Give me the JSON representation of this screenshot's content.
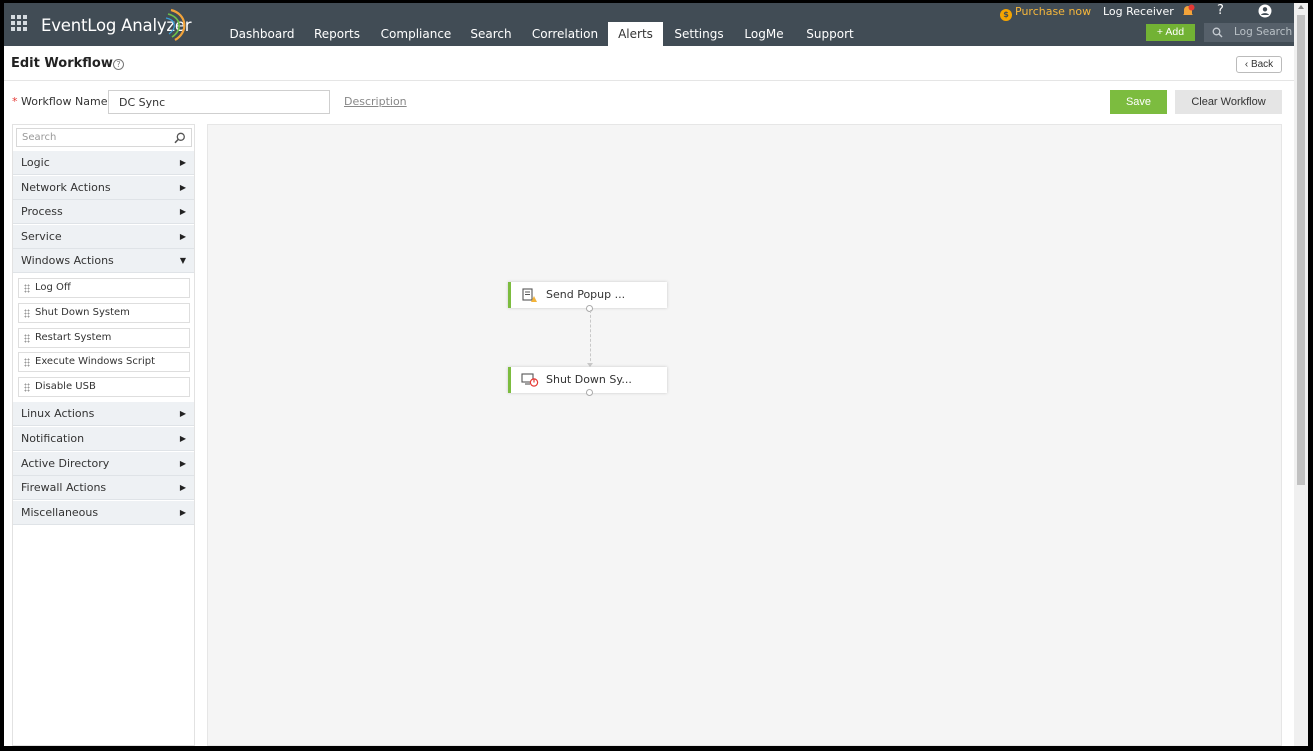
{
  "app": {
    "name": "EventLog Analyzer"
  },
  "nav": {
    "tabs": [
      {
        "label": "Dashboard"
      },
      {
        "label": "Reports"
      },
      {
        "label": "Compliance"
      },
      {
        "label": "Search"
      },
      {
        "label": "Correlation"
      },
      {
        "label": "Alerts",
        "active": true
      },
      {
        "label": "Settings"
      },
      {
        "label": "LogMe"
      },
      {
        "label": "Support"
      }
    ]
  },
  "topright": {
    "purchase": "Purchase now",
    "log_receiver": "Log Receiver",
    "help": "?",
    "add": "+ Add",
    "log_search": "Log Search",
    "bell_badge_color": "#e53935",
    "accent_green": "#72b234"
  },
  "page": {
    "title": "Edit Workflow",
    "help": "?",
    "back": "Back"
  },
  "workflow": {
    "name_label": "Workflow Name",
    "required_mark": "*",
    "name_value": "DC Sync",
    "description_link": "Description",
    "save": "Save",
    "clear": "Clear Workflow"
  },
  "sidebar": {
    "search_placeholder": "Search",
    "categories": [
      {
        "label": "Logic",
        "expanded": false
      },
      {
        "label": "Network Actions",
        "expanded": false
      },
      {
        "label": "Process",
        "expanded": false
      },
      {
        "label": "Service",
        "expanded": false
      },
      {
        "label": "Windows Actions",
        "expanded": true
      },
      {
        "label": "Linux Actions",
        "expanded": false
      },
      {
        "label": "Notification",
        "expanded": false
      },
      {
        "label": "Active Directory",
        "expanded": false
      },
      {
        "label": "Firewall Actions",
        "expanded": false
      },
      {
        "label": "Miscellaneous",
        "expanded": false
      }
    ],
    "windows_actions": [
      {
        "label": "Log Off"
      },
      {
        "label": "Shut Down System"
      },
      {
        "label": "Restart System"
      },
      {
        "label": "Execute Windows Script"
      },
      {
        "label": "Disable USB"
      }
    ]
  },
  "canvas": {
    "nodes": [
      {
        "label": "Send Popup ...",
        "icon": "popup-alert-icon"
      },
      {
        "label": "Shut Down Sy...",
        "icon": "shutdown-system-icon"
      }
    ]
  }
}
